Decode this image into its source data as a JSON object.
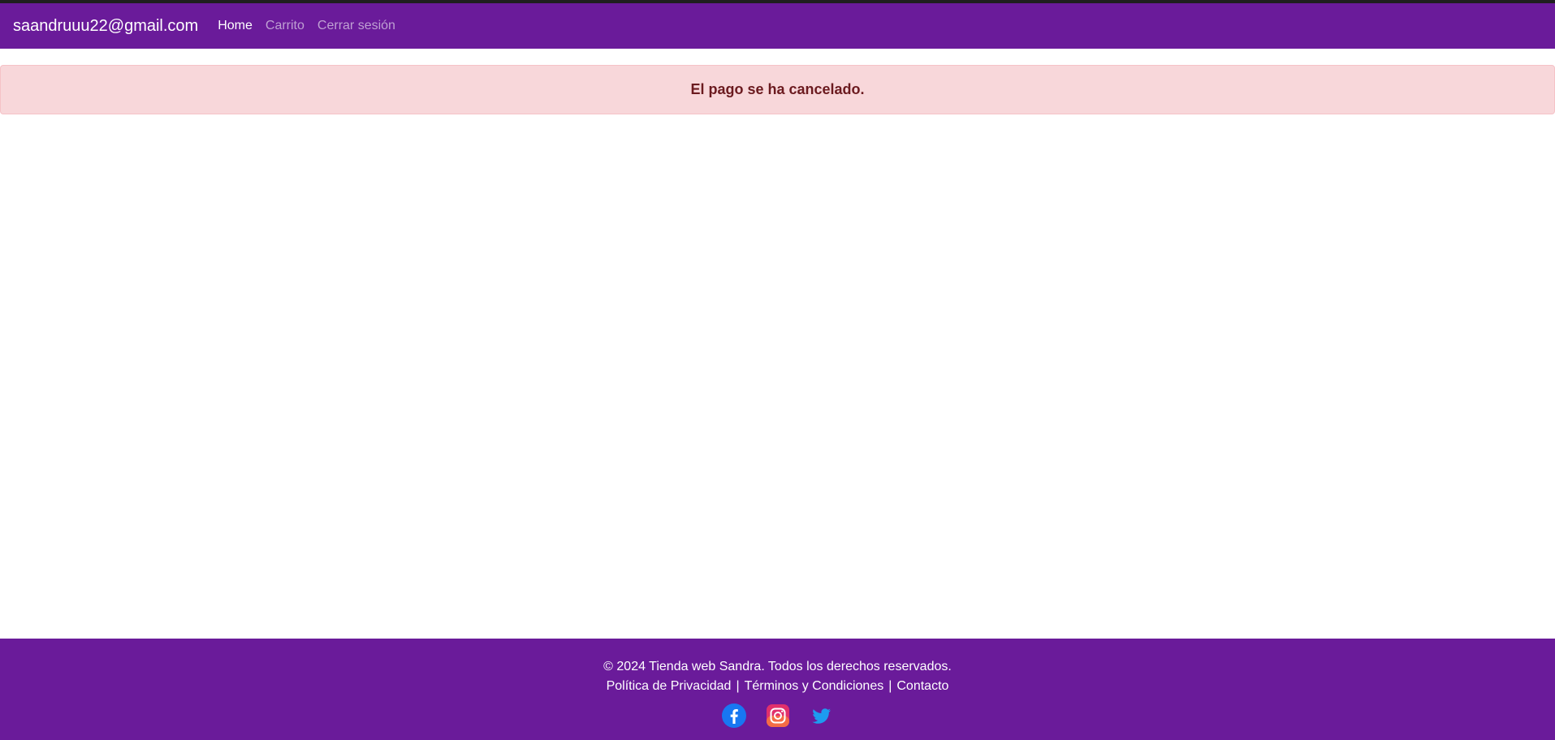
{
  "navbar": {
    "brand": "saandruuu22@gmail.com",
    "links": [
      {
        "label": "Home",
        "active": true
      },
      {
        "label": "Carrito",
        "active": false
      },
      {
        "label": "Cerrar sesión",
        "active": false
      }
    ],
    "background_color": "#6a1b9a"
  },
  "alert": {
    "message": "El pago se ha cancelado.",
    "background_color": "#f8d7da",
    "text_color": "#6b1a1f"
  },
  "footer": {
    "copyright": "© 2024 Tienda web Sandra. Todos los derechos reservados.",
    "links": [
      "Política de Privacidad",
      "Términos y Condiciones",
      "Contacto"
    ],
    "separator": "|",
    "social_icons": [
      "facebook-icon",
      "instagram-icon",
      "twitter-icon"
    ],
    "background_color": "#6a1b9a"
  }
}
